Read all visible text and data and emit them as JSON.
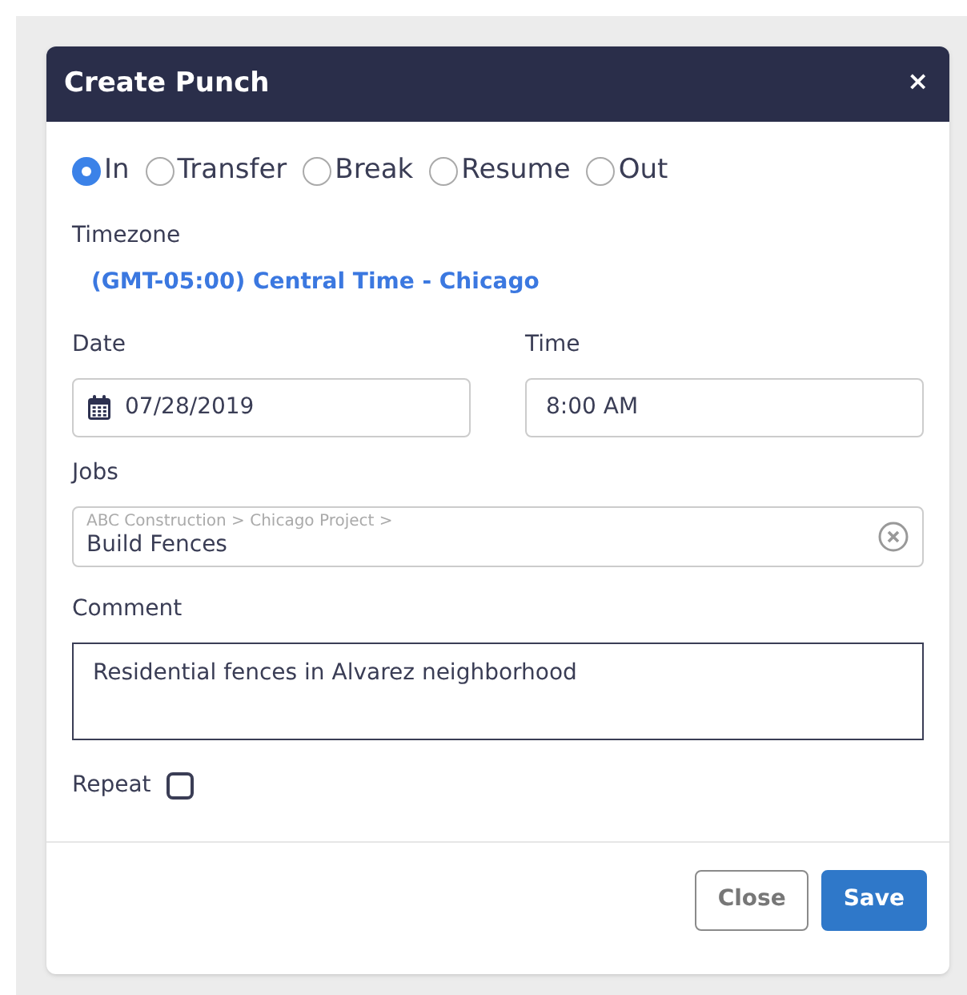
{
  "dialog": {
    "title": "Create Punch",
    "close_icon": "×"
  },
  "punch_types": [
    {
      "label": "In",
      "selected": true
    },
    {
      "label": "Transfer",
      "selected": false
    },
    {
      "label": "Break",
      "selected": false
    },
    {
      "label": "Resume",
      "selected": false
    },
    {
      "label": "Out",
      "selected": false
    }
  ],
  "timezone": {
    "label": "Timezone",
    "value": "(GMT-05:00) Central Time - Chicago"
  },
  "date": {
    "label": "Date",
    "value": "07/28/2019"
  },
  "time": {
    "label": "Time",
    "value": "8:00 AM"
  },
  "jobs": {
    "label": "Jobs",
    "path": "ABC Construction > Chicago Project >",
    "value": "Build Fences"
  },
  "comment": {
    "label": "Comment",
    "value": "Residential fences in Alvarez neighborhood"
  },
  "repeat": {
    "label": "Repeat",
    "checked": false
  },
  "buttons": [
    {
      "label": "Close",
      "kind": "secondary"
    },
    {
      "label": "Save",
      "kind": "primary"
    }
  ]
}
